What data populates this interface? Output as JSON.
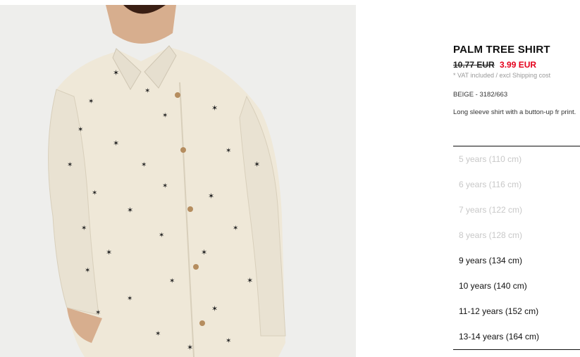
{
  "product": {
    "title": "PALM TREE SHIRT",
    "old_price": "10.77 EUR",
    "sale_price": "3.99 EUR",
    "vat_note": "* VAT included / excl Shipping cost",
    "color_ref": "BEIGE - 3182/663",
    "description": "Long sleeve shirt with a button-up fr print."
  },
  "sizes": [
    {
      "label": "5 years (110 cm)",
      "available": false
    },
    {
      "label": "6 years (116 cm)",
      "available": false
    },
    {
      "label": "7 years (122 cm)",
      "available": false
    },
    {
      "label": "8 years (128 cm)",
      "available": false
    },
    {
      "label": "9 years (134 cm)",
      "available": true
    },
    {
      "label": "10 years (140 cm)",
      "available": true
    },
    {
      "label": "11-12 years (152 cm)",
      "available": true
    },
    {
      "label": "13-14 years (164 cm)",
      "available": true
    }
  ],
  "colors": {
    "sale": "#e4001b",
    "unavailable": "#c8c8c8",
    "shirt": "#efe8d8"
  }
}
